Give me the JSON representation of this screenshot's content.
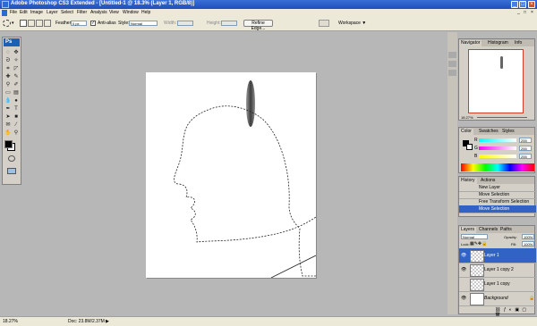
{
  "window": {
    "title": "Adobe Photoshop CS3 Extended - [Untitled-1 @ 18.3% (Layer 1, RGB/8)]",
    "buttons": [
      "_",
      "□",
      "×"
    ]
  },
  "menus": [
    "File",
    "Edit",
    "Image",
    "Layer",
    "Select",
    "Filter",
    "Analysis",
    "View",
    "Window",
    "Help"
  ],
  "options": {
    "feather_label": "Feather:",
    "feather_value": "0 px",
    "antialias_label": "Anti-alias",
    "style_label": "Style:",
    "style_value": "Normal",
    "width_label": "Width:",
    "height_label": "Height:",
    "refine_label": "Refine Edge...",
    "workspace_label": "Workspace ▼"
  },
  "toolbox": {
    "logo": "Ps"
  },
  "navigator": {
    "tabs": [
      "Navigator",
      "Histogram",
      "Info"
    ],
    "zoom": "18.27%"
  },
  "color": {
    "tabs": [
      "Color",
      "Swatches",
      "Styles"
    ],
    "channels": [
      {
        "label": "R",
        "value": "255"
      },
      {
        "label": "G",
        "value": "255"
      },
      {
        "label": "B",
        "value": "255"
      }
    ]
  },
  "history": {
    "tabs": [
      "History",
      "Actions"
    ],
    "items": [
      "New Layer",
      "Move Selection",
      "Free Transform Selection",
      "Move Selection"
    ]
  },
  "layers": {
    "tabs": [
      "Layers",
      "Channels",
      "Paths"
    ],
    "blend_mode": "Normal",
    "opacity_label": "Opacity:",
    "opacity": "100%",
    "lock_label": "Lock:",
    "fill_label": "Fill:",
    "fill": "100%",
    "items": [
      "Layer 1",
      "Layer 1 copy 2",
      "Layer 1 copy",
      "Background"
    ]
  },
  "status": {
    "zoom": "18.27%",
    "doc": "Doc: 23.8M/2.37M"
  }
}
